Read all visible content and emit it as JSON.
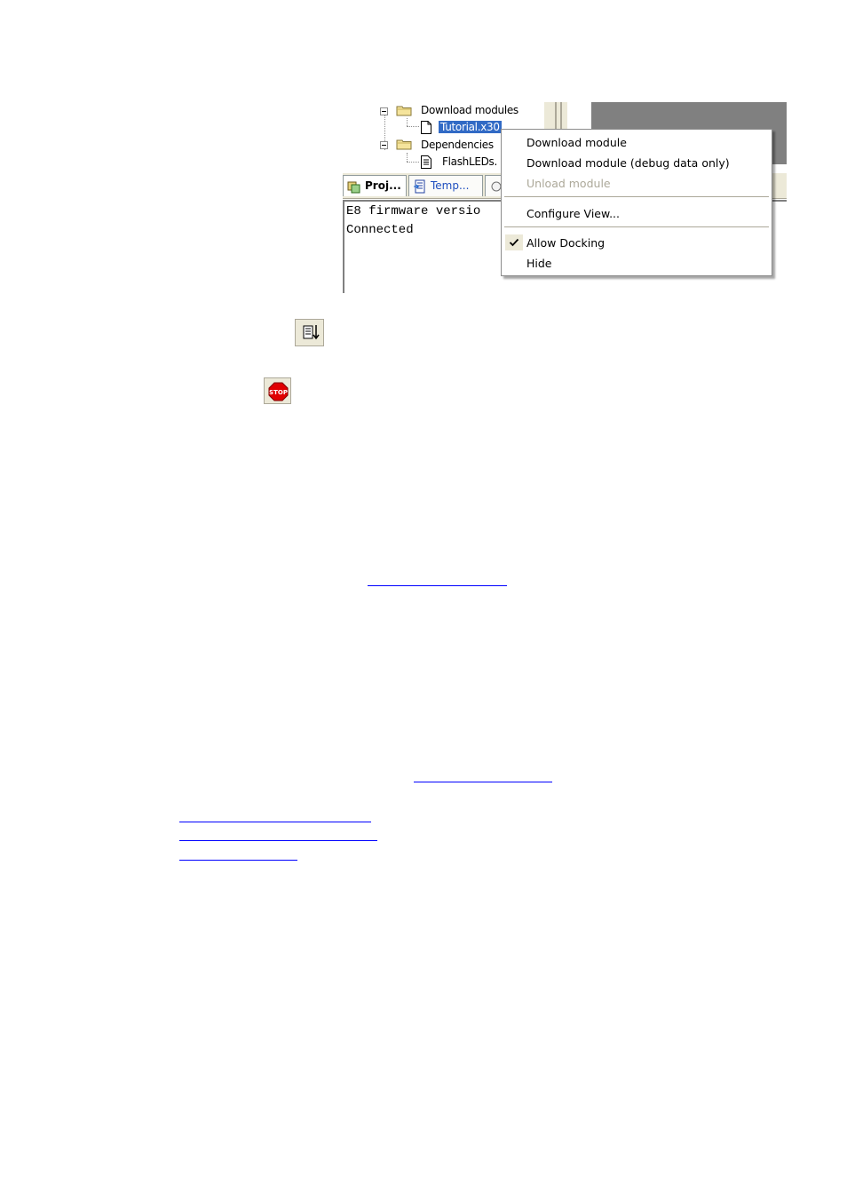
{
  "tree": {
    "items": [
      {
        "label": "Download modules"
      },
      {
        "label": "Tutorial.x30"
      },
      {
        "label": "Dependencies"
      },
      {
        "label": "FlashLEDs."
      }
    ]
  },
  "tabs": [
    {
      "label": "Proj..."
    },
    {
      "label": "Temp..."
    }
  ],
  "output": {
    "lines": [
      "E8 firmware versio",
      "Connected"
    ]
  },
  "context_menu": {
    "items": [
      {
        "label": "Download module"
      },
      {
        "label": "Download module (debug data only)"
      },
      {
        "label": "Unload module",
        "disabled": true
      },
      {
        "label": "Configure View..."
      },
      {
        "label": "Allow Docking",
        "checked": true
      },
      {
        "label": "Hide"
      }
    ]
  },
  "icons": {
    "download": "download-module-icon",
    "stop": "stop-icon"
  },
  "colors": {
    "selection": "#316ac5",
    "link": "#0000ff",
    "stop_red": "#e00000"
  }
}
